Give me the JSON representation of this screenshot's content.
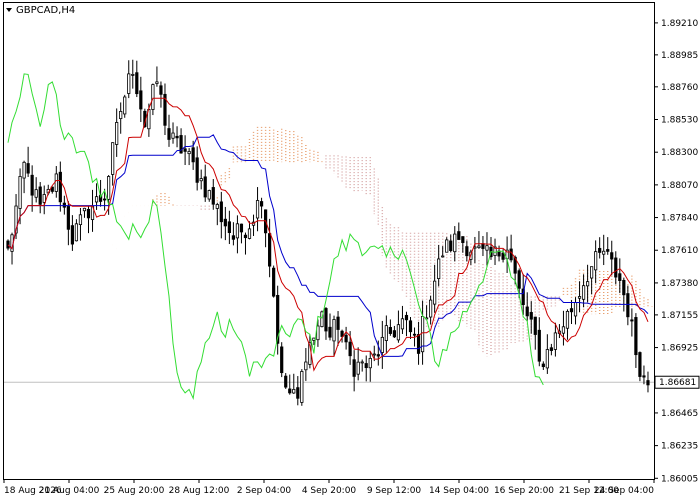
{
  "symbol_label": "GBPCAD,H4",
  "colors": {
    "background": "#ffffff",
    "frame": "#000000",
    "candle": "#000000",
    "tenkan": "#cc0000",
    "kijun": "#0000cc",
    "chikou": "#33dd33",
    "cloud_bull": "#e8a070",
    "cloud_bear": "#d8a8a8",
    "price_line": "#c0c0c0",
    "price_box": "#ffffff"
  },
  "chart_data": {
    "type": "candlestick",
    "indicator": "ichimoku",
    "ylim": [
      1.86,
      1.8935
    ],
    "y_ticks": [
      1.8921,
      1.88985,
      1.8876,
      1.8853,
      1.883,
      1.8807,
      1.8784,
      1.8761,
      1.8738,
      1.87155,
      1.86925,
      1.86695,
      1.86465,
      1.86235,
      1.86005
    ],
    "y_tick_labels": [
      "1.89210",
      "1.88985",
      "1.88760",
      "1.88530",
      "1.88300",
      "1.88070",
      "1.87840",
      "1.87610",
      "1.87380",
      "1.87155",
      "1.86925",
      "1.86695",
      "1.86465",
      "1.86235",
      "1.86005"
    ],
    "x_labels": [
      "18 Aug 2026",
      "21 Aug 04:00",
      "25 Aug 20:00",
      "28 Aug 12:00",
      "2 Sep 04:00",
      "4 Sep 20:00",
      "9 Sep 12:00",
      "14 Sep 04:00",
      "16 Sep 20:00",
      "21 Sep 12:00",
      "24 Sep 04:00"
    ],
    "current_price": 1.86681,
    "current_price_label": "1.86681",
    "bar_count": 160,
    "close_anchors": [
      [
        0,
        1.876
      ],
      [
        4,
        1.882
      ],
      [
        8,
        1.879
      ],
      [
        12,
        1.881
      ],
      [
        16,
        1.877
      ],
      [
        20,
        1.879
      ],
      [
        24,
        1.88
      ],
      [
        28,
        1.886
      ],
      [
        31,
        1.889
      ],
      [
        34,
        1.885
      ],
      [
        37,
        1.888
      ],
      [
        40,
        1.884
      ],
      [
        44,
        1.883
      ],
      [
        48,
        1.881
      ],
      [
        52,
        1.879
      ],
      [
        56,
        1.877
      ],
      [
        60,
        1.878
      ],
      [
        63,
        1.88
      ],
      [
        66,
        1.873
      ],
      [
        68,
        1.867
      ],
      [
        70,
        1.866
      ],
      [
        72,
        1.8655
      ],
      [
        74,
        1.869
      ],
      [
        76,
        1.87
      ],
      [
        78,
        1.8715
      ],
      [
        80,
        1.87
      ],
      [
        82,
        1.871
      ],
      [
        84,
        1.869
      ],
      [
        86,
        1.868
      ],
      [
        90,
        1.868
      ],
      [
        94,
        1.87
      ],
      [
        98,
        1.871
      ],
      [
        102,
        1.8695
      ],
      [
        104,
        1.872
      ],
      [
        106,
        1.874
      ],
      [
        108,
        1.876
      ],
      [
        112,
        1.877
      ],
      [
        116,
        1.876
      ],
      [
        120,
        1.8755
      ],
      [
        124,
        1.8765
      ],
      [
        128,
        1.872
      ],
      [
        130,
        1.871
      ],
      [
        132,
        1.868
      ],
      [
        134,
        1.869
      ],
      [
        136,
        1.87
      ],
      [
        140,
        1.872
      ],
      [
        144,
        1.8745
      ],
      [
        148,
        1.876
      ],
      [
        152,
        1.874
      ],
      [
        154,
        1.872
      ],
      [
        156,
        1.869
      ],
      [
        158,
        1.867
      ],
      [
        159,
        1.8668
      ]
    ],
    "series": [
      {
        "name": "Tenkan-sen",
        "color": "#cc0000"
      },
      {
        "name": "Kijun-sen",
        "color": "#0000cc"
      },
      {
        "name": "Senkou Span A",
        "color": "#e8a070"
      },
      {
        "name": "Senkou Span B",
        "color": "#d8a8a8"
      },
      {
        "name": "Chikou Span",
        "color": "#33dd33"
      }
    ],
    "grid": false,
    "legend": "none"
  }
}
